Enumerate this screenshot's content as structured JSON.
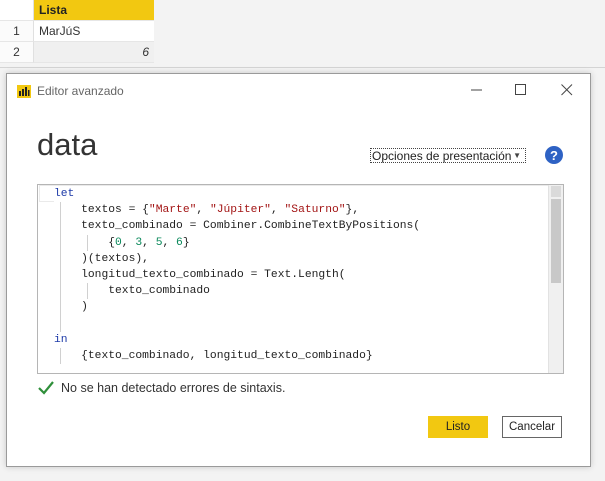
{
  "grid": {
    "column_header": "Lista",
    "rows": [
      {
        "index": "1",
        "value": "MarJúS"
      },
      {
        "index": "2",
        "value": "6"
      }
    ]
  },
  "dialog": {
    "title": "Editor avanzado",
    "query_name": "data",
    "display_options_label": "Opciones de presentación",
    "help_label": "?",
    "code": {
      "l1_kw": "let",
      "l2_a": "    textos = {",
      "l2_s1": "\"Marte\"",
      "l2_c1": ", ",
      "l2_s2": "\"Júpiter\"",
      "l2_c2": ", ",
      "l2_s3": "\"Saturno\"",
      "l2_end": "},",
      "l3": "    texto_combinado = Combiner.CombineTextByPositions(",
      "l4_a": "        {",
      "l4_n1": "0",
      "l4_c1": ", ",
      "l4_n2": "3",
      "l4_c2": ", ",
      "l4_n3": "5",
      "l4_c3": ", ",
      "l4_n4": "6",
      "l4_end": "}",
      "l5": "    )(textos),",
      "l6": "    longitud_texto_combinado = Text.Length(",
      "l7": "        texto_combinado",
      "l8": "    )",
      "l9": "",
      "l10_kw": "in",
      "l11": "    {texto_combinado, longitud_texto_combinado}"
    },
    "status_text": "No se han detectado errores de sintaxis.",
    "ok_label": "Listo",
    "cancel_label": "Cancelar"
  },
  "colors": {
    "accent": "#f2c811",
    "keyword": "#1d3aa8",
    "string": "#a31515",
    "number": "#09885a",
    "success": "#2f8f3a",
    "help": "#2e62c4"
  },
  "icons": {
    "app": "power-bi-icon",
    "minimize": "minimize-icon",
    "maximize": "maximize-icon",
    "close": "close-icon",
    "help": "help-icon",
    "status": "check-icon"
  }
}
